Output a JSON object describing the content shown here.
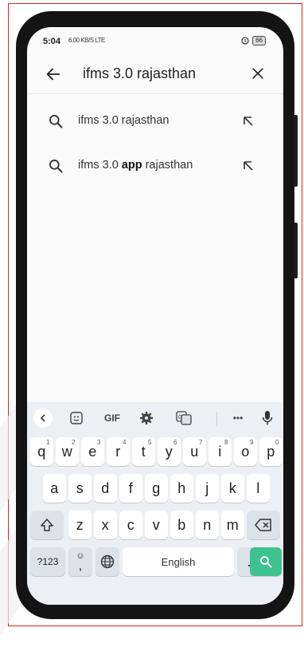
{
  "status": {
    "time": "5:04",
    "network": "6.00 KB/S LTE",
    "battery": "66"
  },
  "search": {
    "query": "ifms 3.0 rajasthan"
  },
  "suggestions": [
    {
      "prefix": "ifms 3.0 ",
      "bold": "",
      "suffix": "rajasthan"
    },
    {
      "prefix": "ifms 3.0 ",
      "bold": "app",
      "suffix": " rajasthan"
    }
  ],
  "keyboard": {
    "toolbar": {
      "gif": "GIF",
      "more": "•••"
    },
    "row1": [
      {
        "k": "q",
        "h": "1"
      },
      {
        "k": "w",
        "h": "2"
      },
      {
        "k": "e",
        "h": "3"
      },
      {
        "k": "r",
        "h": "4"
      },
      {
        "k": "t",
        "h": "5"
      },
      {
        "k": "y",
        "h": "6"
      },
      {
        "k": "u",
        "h": "7"
      },
      {
        "k": "i",
        "h": "8"
      },
      {
        "k": "o",
        "h": "9"
      },
      {
        "k": "p",
        "h": "0"
      }
    ],
    "row2": [
      "a",
      "s",
      "d",
      "f",
      "g",
      "h",
      "j",
      "k",
      "l"
    ],
    "row3": [
      "z",
      "x",
      "c",
      "v",
      "b",
      "n",
      "m"
    ],
    "symbols": "?123",
    "comma": ",",
    "space": "English",
    "period": "."
  },
  "colors": {
    "enter": "#3ec28f",
    "frame": "#e02020"
  }
}
